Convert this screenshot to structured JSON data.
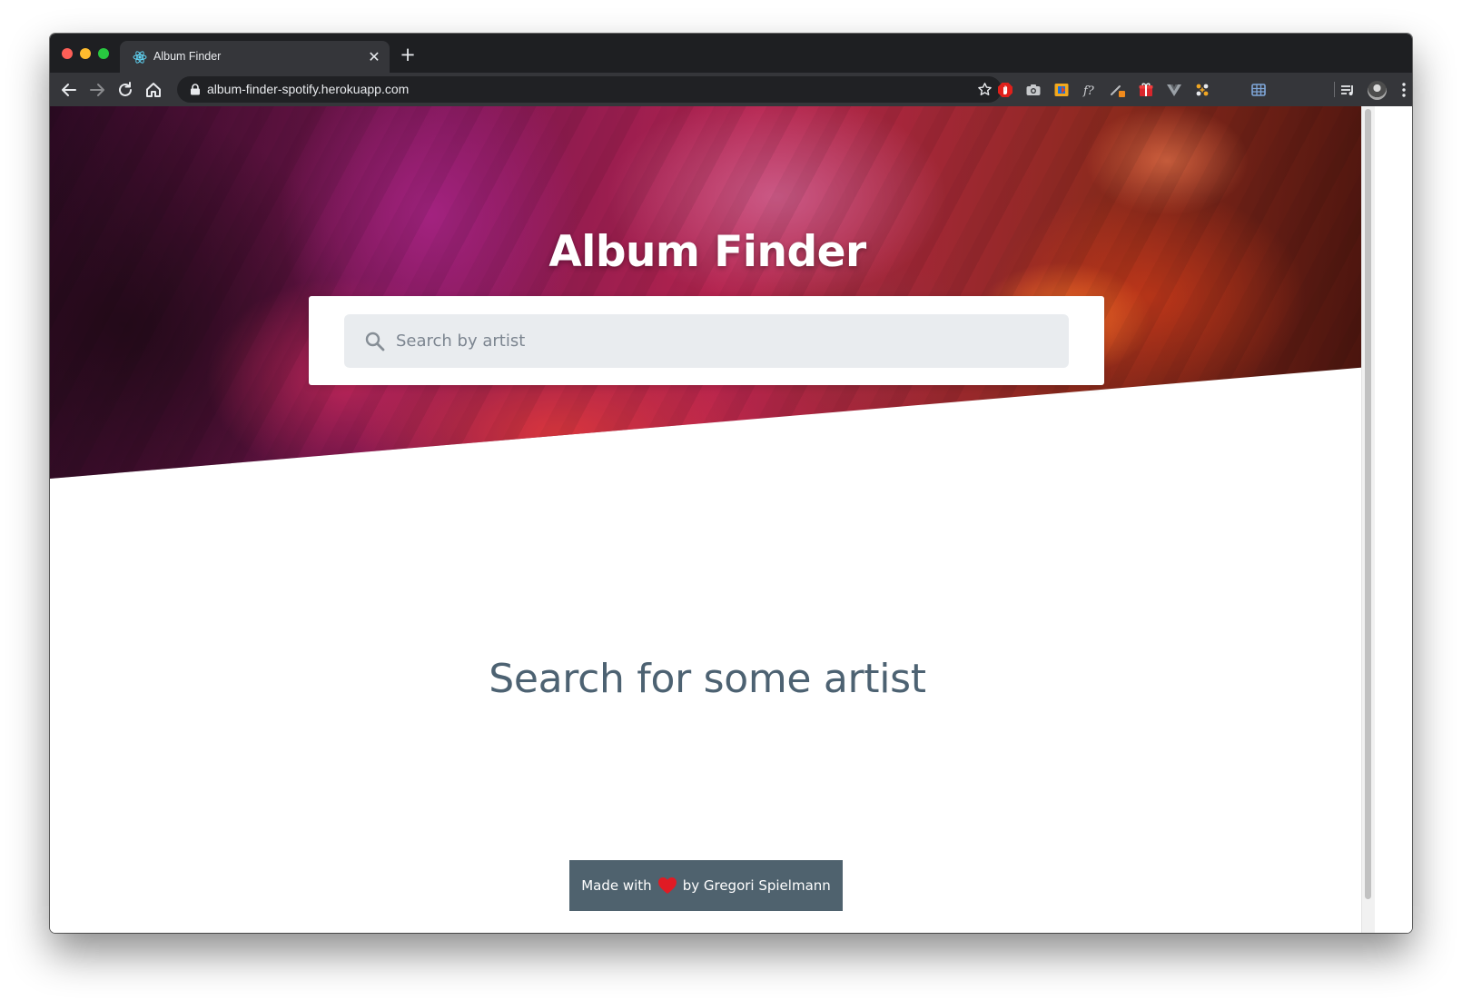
{
  "browser": {
    "tab": {
      "title": "Album Finder",
      "close_glyph": "✕",
      "favicon": "react-icon"
    },
    "new_tab_glyph": "+",
    "address": {
      "url": "album-finder-spotify.herokuapp.com"
    },
    "extensions": [
      "ad-blocker-icon",
      "camera-icon",
      "extension-box-icon",
      "font-detector-icon",
      "eyedropper-icon",
      "gift-icon",
      "vue-devtools-icon",
      "sparkle-extension-icon",
      "layout-grid-icon",
      "playlist-icon"
    ]
  },
  "page": {
    "title": "Album Finder",
    "search": {
      "placeholder": "Search by artist",
      "value": ""
    },
    "empty_state": "Search for some artist",
    "footer": {
      "prefix": "Made with",
      "suffix": "by Gregori Spielmann"
    }
  },
  "colors": {
    "tab_strip": "#1e1f22",
    "toolbar": "#35363a",
    "omnibox": "#202124",
    "search_box": "#e9ecef",
    "empty_state_text": "#4d6272",
    "footer_bg": "#4f626e",
    "heart": "#e01b24"
  }
}
